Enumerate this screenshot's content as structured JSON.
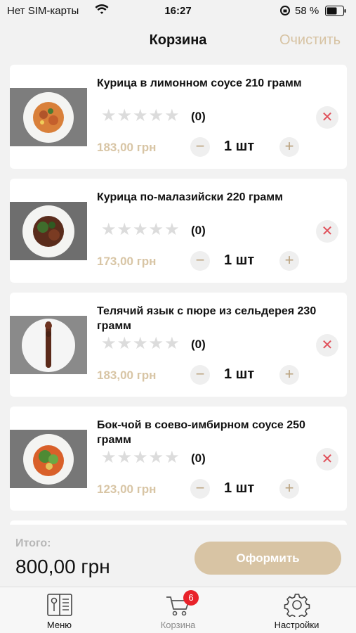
{
  "status_bar": {
    "carrier": "Нет SIM-карты",
    "time": "16:27",
    "battery": "58 %"
  },
  "nav": {
    "title": "Корзина",
    "clear_label": "Очистить"
  },
  "items": [
    {
      "name": "Курица в лимонном соусе 210 грамм",
      "rating_count": "(0)",
      "price": "183,00 грн",
      "quantity": "1 шт",
      "rating": 0
    },
    {
      "name": "Курица по-малазийски 220 грамм",
      "rating_count": "(0)",
      "price": "173,00 грн",
      "quantity": "1 шт",
      "rating": 0
    },
    {
      "name": "Телячий язык с пюре из сельдерея 230 грамм",
      "rating_count": "(0)",
      "price": "183,00 грн",
      "quantity": "1 шт",
      "rating": 0
    },
    {
      "name": "Бок-чой в соево-имбирном соусе 250 грамм",
      "rating_count": "(0)",
      "price": "123,00 грн",
      "quantity": "1 шт",
      "rating": 0
    }
  ],
  "summary": {
    "total_label": "Итого:",
    "total_value": "800,00 грн",
    "checkout_label": "Оформить"
  },
  "tabs": [
    {
      "label": "Меню",
      "icon": "menu-book-icon"
    },
    {
      "label": "Корзина",
      "icon": "cart-icon",
      "badge": "6",
      "active": true
    },
    {
      "label": "Настройки",
      "icon": "gear-icon"
    }
  ],
  "colors": {
    "accent": "#d8c4a4",
    "remove": "#e0505a",
    "badge": "#e8222a"
  }
}
